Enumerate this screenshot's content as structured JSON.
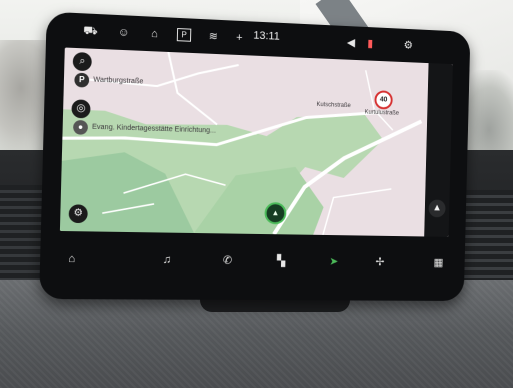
{
  "status_bar": {
    "time": "13:11",
    "icons": [
      "car-icon",
      "person-icon",
      "seat-icon",
      "parking-icon",
      "hvac-icon",
      "plus-icon",
      "volume-icon",
      "signal-icon"
    ]
  },
  "map": {
    "street_label": "Wartburgstraße",
    "poi_label": "Evang. Kindertagesstätte Einrichtung...",
    "road_label_1": "Kutschstraße",
    "road_label_2": "Kurtulustraße",
    "speed_limit": "40",
    "parking_symbol": "P",
    "colors": {
      "land": "#eadfe3",
      "park": "#b8d9b2",
      "road": "#ffffff"
    }
  },
  "nav_bar": {
    "items": [
      "home-icon",
      "music-icon",
      "phone-icon",
      "apps-icon",
      "navigation-icon",
      "fan-icon",
      "grid-icon"
    ]
  }
}
